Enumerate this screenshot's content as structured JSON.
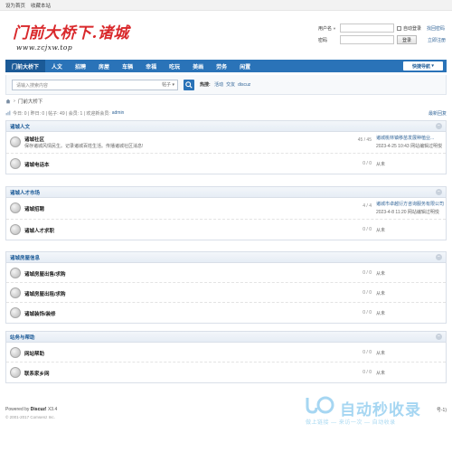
{
  "topbar": {
    "set_home": "设为首页",
    "bookmark": "收藏本站"
  },
  "logo": {
    "title": "门前大桥下.诸城",
    "url_text": "www.zcjxw.top"
  },
  "login": {
    "username_label": "用户名",
    "password_label": "密码",
    "auto_login": "自动登录",
    "forgot_password": "找回密码",
    "login_button": "登录",
    "register": "立即注册"
  },
  "nav": {
    "items": [
      "门前大桥下",
      "人文",
      "招聘",
      "房屋",
      "车辆",
      "幸福",
      "吃玩",
      "美画",
      "劳务",
      "闲置"
    ],
    "active_index": 0,
    "quick_nav": "快捷导航"
  },
  "search": {
    "placeholder": "请输入搜索内容",
    "type": "帖子",
    "hot_label": "热搜:",
    "hot_terms": [
      "活动",
      "交友",
      "discuz"
    ]
  },
  "breadcrumb": {
    "home_icon": "home-icon",
    "separator": "›",
    "current": "门前大桥下"
  },
  "stats": {
    "text": "今日: 0 | 昨日: 0 | 帖子: 49 | 会员: 1 | 欢迎新会员:",
    "new_member": "admin",
    "newest_reply": "最新回复"
  },
  "sections": [
    {
      "title": "诸城人文",
      "forums": [
        {
          "name": "诸城社区",
          "desc": "保存诸城风情民生。记录诸城百姓生活。传播诸城社区消息!",
          "count": "45 / 45",
          "last_title": "诸城桃林镇移苗发展种植业...",
          "last_time": "2023-4-25 10:43 网站编辑过明悦"
        },
        {
          "name": "诸城电话本",
          "desc": "",
          "count": "0 / 0",
          "last_title": "从未",
          "last_time": ""
        }
      ]
    },
    {
      "title": "诸城人才市场",
      "forums": [
        {
          "name": "诸城招聘",
          "desc": "",
          "count": "4 / 4",
          "last_title": "诸城市卓越衍方咨询服务有限公司",
          "last_time": "2023-4-8 11:20 网站编辑过明悦"
        },
        {
          "name": "诸城人才求职",
          "desc": "",
          "count": "0 / 0",
          "last_title": "从未",
          "last_time": ""
        }
      ]
    },
    {
      "title": "诸城房屋信息",
      "forums": [
        {
          "name": "诸城房屋出售/求购",
          "desc": "",
          "count": "0 / 0",
          "last_title": "从未",
          "last_time": ""
        },
        {
          "name": "诸城房屋出租/求购",
          "desc": "",
          "count": "0 / 0",
          "last_title": "从未",
          "last_time": ""
        },
        {
          "name": "诸城装饰/装修",
          "desc": "",
          "count": "0 / 0",
          "last_title": "从未",
          "last_time": ""
        }
      ]
    },
    {
      "title": "站务与帮助",
      "forums": [
        {
          "name": "网站帮助",
          "desc": "",
          "count": "0 / 0",
          "last_title": "从未",
          "last_time": ""
        },
        {
          "name": "联系家乡网",
          "desc": "",
          "count": "0 / 0",
          "last_title": "从未",
          "last_time": ""
        }
      ]
    }
  ],
  "footer": {
    "powered_prefix": "Powered by",
    "powered_name": "Discuz!",
    "version": "X3.4",
    "copyright": "© 2001-2017 Comsenz Inc.",
    "right_text": "号-1)"
  },
  "watermark": {
    "main": "自动秒收录",
    "sub": "做上链接 — 来访一次 — 自动收录"
  }
}
